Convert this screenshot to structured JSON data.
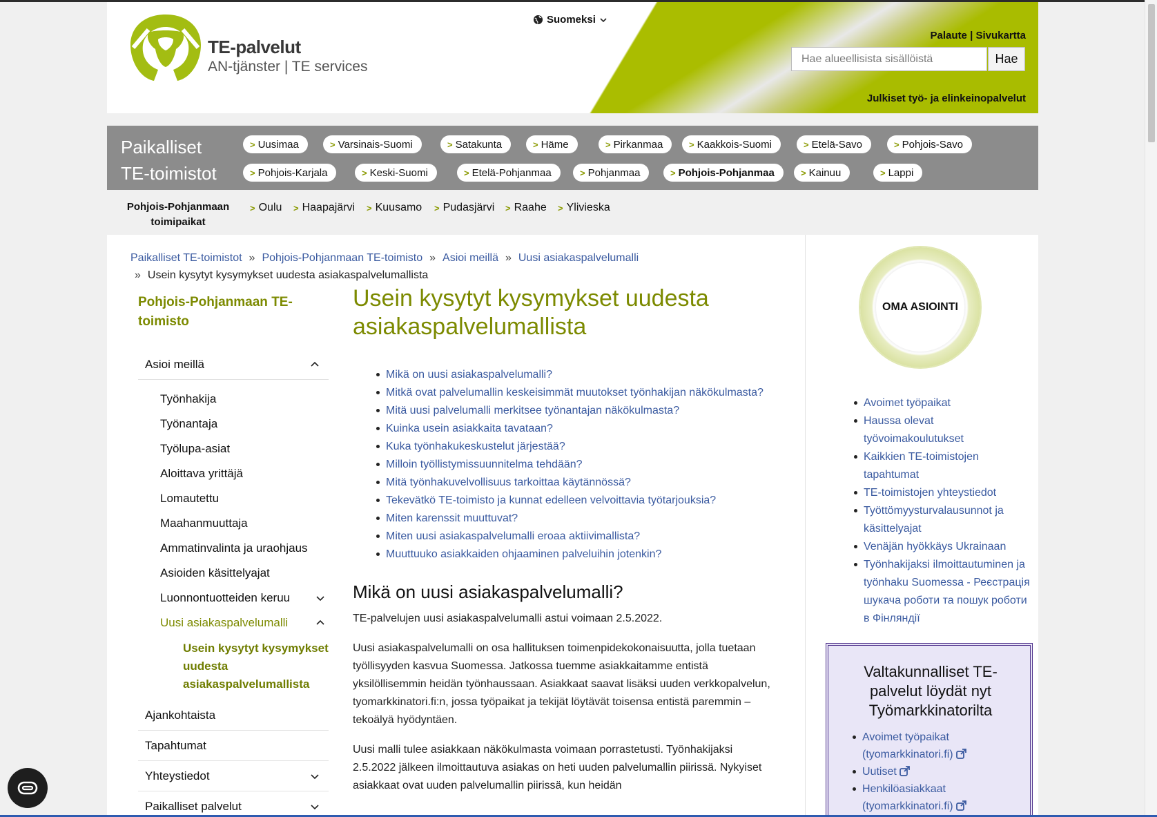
{
  "header": {
    "brand_name": "TE-palvelut",
    "brand_sub": "AN-tjänster | TE services",
    "language": "Suomeksi",
    "feedback": "Palaute",
    "sitemap": "Sivukartta",
    "link_separator": "|",
    "search_placeholder": "Hae alueellisista sisällöistä",
    "search_button": "Hae",
    "tagline": "Julkiset työ- ja elinkeinopalvelut",
    "accent_color": "#aabd00"
  },
  "regions": {
    "title_line1": "Paikalliset",
    "title_line2": "TE-toimistot",
    "row1": [
      "Uusimaa",
      "Varsinais-Suomi",
      "Satakunta",
      "Häme",
      "Pirkanmaa",
      "Kaakkois-Suomi",
      "Etelä-Savo",
      "Pohjois-Savo"
    ],
    "row2": [
      "Pohjois-Karjala",
      "Keski-Suomi",
      "Etelä-Pohjanmaa",
      "Pohjanmaa",
      "Pohjois-Pohjanmaa",
      "Kainuu",
      "Lappi"
    ],
    "active": "Pohjois-Pohjanmaa"
  },
  "offices": {
    "title": "Pohjois-Pohjanmaan toimipaikat",
    "links": [
      "Oulu",
      "Haapajärvi",
      "Kuusamo",
      "Pudasjärvi",
      "Raahe",
      "Ylivieska"
    ]
  },
  "breadcrumb": {
    "items": [
      "Paikalliset TE-toimistot",
      "Pohjois-Pohjanmaan TE-toimisto",
      "Asioi meillä",
      "Uusi asiakaspalvelumalli"
    ],
    "current": "Usein kysytyt kysymykset uudesta asiakaspalvelumallista",
    "separator": "»"
  },
  "leftnav": {
    "title": "Pohjois-Pohjanmaan TE-toimisto",
    "section": "Asioi meillä",
    "sub": [
      "Työnhakija",
      "Työnantaja",
      "Työlupa-asiat",
      "Aloittava yrittäjä",
      "Lomautettu",
      "Maahanmuuttaja",
      "Ammatinvalinta ja uraohjaus",
      "Asioiden käsittelyajat",
      "Luonnontuotteiden keruu",
      "Uusi asiakaspalvelumalli"
    ],
    "current": "Usein kysytyt kysymykset uudesta asiakaspalvelumallista",
    "bottom": [
      "Ajankohtaista",
      "Tapahtumat",
      "Yhteystiedot",
      "Paikalliset palvelut"
    ]
  },
  "main": {
    "title": "Usein kysytyt kysymykset uudesta asiakaspalvelumallista",
    "toc": [
      "Mikä on uusi asiakaspalvelumalli?",
      "Mitkä ovat palvelumallin keskeisimmät muutokset työnhakijan näkökulmasta?",
      "Mitä uusi palvelumalli merkitsee työnantajan näkökulmasta?",
      "Kuinka usein asiakkaita tavataan?",
      "Kuka työnhakukeskustelut järjestää?",
      "Milloin työllistymissuunnitelma tehdään?",
      "Mitä työnhakuvelvollisuus tarkoittaa käytännössä?",
      "Tekevätkö TE-toimisto ja kunnat edelleen velvoittavia työtarjouksia?",
      "Miten karenssit muuttuvat?",
      "Miten uusi asiakaspalvelumalli eroaa aktiivimallista?",
      "Muuttuuko asiakkaiden ohjaaminen palveluihin jotenkin?"
    ],
    "h2": "Mikä on uusi asiakaspalvelumalli?",
    "p1": "TE-palvelujen uusi asiakaspalvelumalli astui voimaan 2.5.2022.",
    "p2": "Uusi asiakaspalvelumalli on osa hallituksen toimenpidekokonaisuutta, jolla tuetaan työllisyyden kasvua Suomessa. Jatkossa tuemme asiakkaitamme entistä yksilöllisemmin heidän työnhaussaan. Asiakkaat saavat lisäksi uuden verkkopalvelun, tyomarkkinatori.fi:n, jossa työpaikat ja tekijät löytävät toisensa entistä paremmin – tekoälyä hyödyntäen.",
    "p3": "Uusi malli tulee asiakkaan näkökulmasta voimaan porrastetusti. Työnhakijaksi 2.5.2022 jälkeen ilmoittautuva asiakas on heti uuden palvelumallin piirissä. Nykyiset asiakkaat ovat uuden palvelumallin piirissä, kun heidän"
  },
  "right": {
    "oma": "OMA ASIOINTI",
    "links": [
      "Avoimet työpaikat",
      "Haussa olevat työvoimakoulutukset",
      "Kaikkien TE-toimistojen tapahtumat",
      "TE-toimistojen yhteystiedot",
      "Työttömyysturvalausunnot ja käsittelyajat",
      "Venäjän hyökkäys Ukrainaan",
      "Työnhakijaksi ilmoittautuminen ja työnhaku Suomessa - Реєстрація шукача роботи та пошук роботи в Фінляндії"
    ],
    "box_title": "Valtakunnalliset TE-palvelut löydät nyt Työmarkkinatorilta",
    "box_links": [
      "Avoimet työpaikat (tyomarkkinatori.fi)",
      "Uutiset",
      "Henkilöasiakkaat (tyomarkkinatori.fi)"
    ]
  }
}
